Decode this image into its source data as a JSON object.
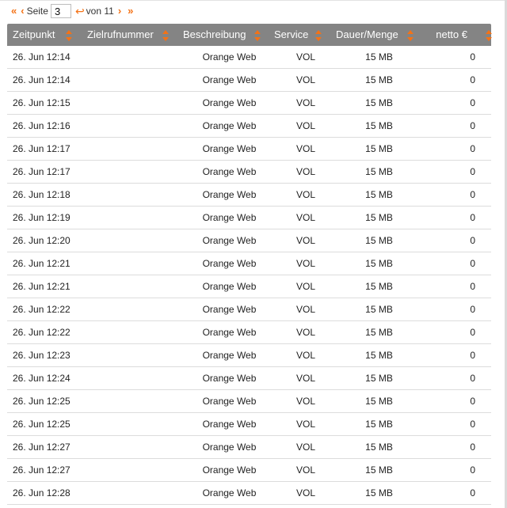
{
  "pagination": {
    "first_label": "«",
    "prev_label": "‹",
    "page_label": "Seite",
    "current_page": "3",
    "go_label": "↩",
    "of_label": "von 11",
    "next_label": "›",
    "last_label": "»"
  },
  "table": {
    "columns": [
      "Zeitpunkt",
      "Zielrufnummer",
      "Beschreibung",
      "Service",
      "Dauer/Menge",
      "netto €"
    ],
    "rows": [
      {
        "time": "26. Jun 12:14",
        "number": "",
        "description": "Orange Web",
        "service": "VOL",
        "amount": "15 MB",
        "net": "0"
      },
      {
        "time": "26. Jun 12:14",
        "number": "",
        "description": "Orange Web",
        "service": "VOL",
        "amount": "15 MB",
        "net": "0"
      },
      {
        "time": "26. Jun 12:15",
        "number": "",
        "description": "Orange Web",
        "service": "VOL",
        "amount": "15 MB",
        "net": "0"
      },
      {
        "time": "26. Jun 12:16",
        "number": "",
        "description": "Orange Web",
        "service": "VOL",
        "amount": "15 MB",
        "net": "0"
      },
      {
        "time": "26. Jun 12:17",
        "number": "",
        "description": "Orange Web",
        "service": "VOL",
        "amount": "15 MB",
        "net": "0"
      },
      {
        "time": "26. Jun 12:17",
        "number": "",
        "description": "Orange Web",
        "service": "VOL",
        "amount": "15 MB",
        "net": "0"
      },
      {
        "time": "26. Jun 12:18",
        "number": "",
        "description": "Orange Web",
        "service": "VOL",
        "amount": "15 MB",
        "net": "0"
      },
      {
        "time": "26. Jun 12:19",
        "number": "",
        "description": "Orange Web",
        "service": "VOL",
        "amount": "15 MB",
        "net": "0"
      },
      {
        "time": "26. Jun 12:20",
        "number": "",
        "description": "Orange Web",
        "service": "VOL",
        "amount": "15 MB",
        "net": "0"
      },
      {
        "time": "26. Jun 12:21",
        "number": "",
        "description": "Orange Web",
        "service": "VOL",
        "amount": "15 MB",
        "net": "0"
      },
      {
        "time": "26. Jun 12:21",
        "number": "",
        "description": "Orange Web",
        "service": "VOL",
        "amount": "15 MB",
        "net": "0"
      },
      {
        "time": "26. Jun 12:22",
        "number": "",
        "description": "Orange Web",
        "service": "VOL",
        "amount": "15 MB",
        "net": "0"
      },
      {
        "time": "26. Jun 12:22",
        "number": "",
        "description": "Orange Web",
        "service": "VOL",
        "amount": "15 MB",
        "net": "0"
      },
      {
        "time": "26. Jun 12:23",
        "number": "",
        "description": "Orange Web",
        "service": "VOL",
        "amount": "15 MB",
        "net": "0"
      },
      {
        "time": "26. Jun 12:24",
        "number": "",
        "description": "Orange Web",
        "service": "VOL",
        "amount": "15 MB",
        "net": "0"
      },
      {
        "time": "26. Jun 12:25",
        "number": "",
        "description": "Orange Web",
        "service": "VOL",
        "amount": "15 MB",
        "net": "0"
      },
      {
        "time": "26. Jun 12:25",
        "number": "",
        "description": "Orange Web",
        "service": "VOL",
        "amount": "15 MB",
        "net": "0"
      },
      {
        "time": "26. Jun 12:27",
        "number": "",
        "description": "Orange Web",
        "service": "VOL",
        "amount": "15 MB",
        "net": "0"
      },
      {
        "time": "26. Jun 12:27",
        "number": "",
        "description": "Orange Web",
        "service": "VOL",
        "amount": "15 MB",
        "net": "0"
      },
      {
        "time": "26. Jun 12:28",
        "number": "",
        "description": "Orange Web",
        "service": "VOL",
        "amount": "15 MB",
        "net": "0"
      }
    ]
  },
  "colors": {
    "accent": "#f47216",
    "header_bg": "#848484",
    "row_border": "#dcdcdc"
  }
}
